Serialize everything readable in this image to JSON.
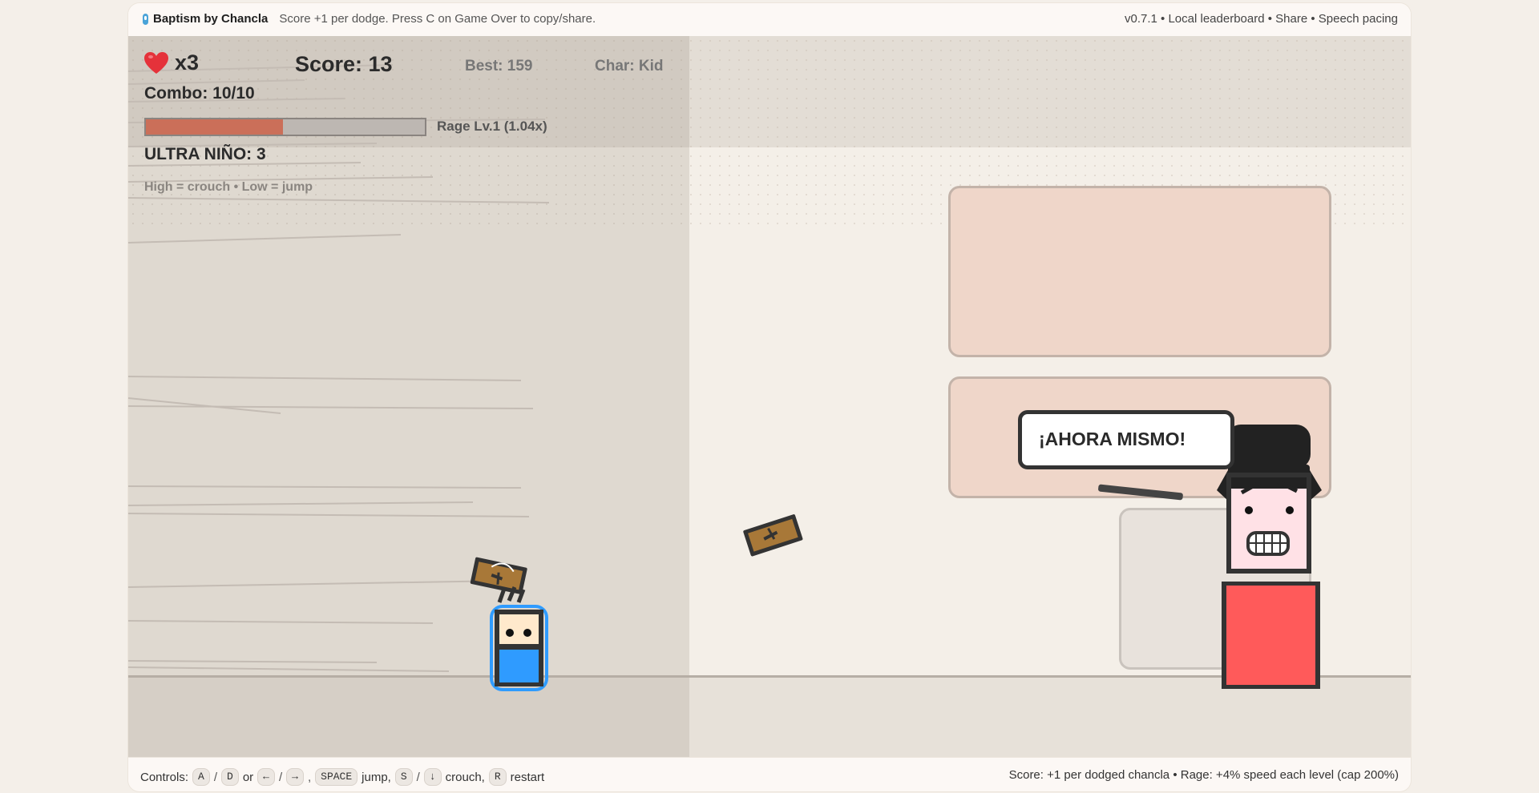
{
  "header": {
    "title": "Baptism by Chancla",
    "tagline": "Score +1 per dodge. Press C on Game Over to copy/share.",
    "meta": "v0.7.1 • Local leaderboard • Share • Speech pacing"
  },
  "hud": {
    "lives": "x3",
    "score": "Score: 13",
    "best": "Best: 159",
    "character": "Char: Kid",
    "combo": "Combo: 10/10",
    "rage_label": "Rage Lv.1 (1.04x)",
    "rage_fill": 0.49,
    "ultra": "ULTRA NIÑO: 3",
    "hint": "High = crouch • Low = jump"
  },
  "speech": {
    "text": "¡AHORA MISMO!"
  },
  "colors": {
    "accent_rage": "#cb6f59",
    "player_shirt": "#2f9bff",
    "mom_dress": "#ff5a5a",
    "chancla": "#a87838"
  },
  "footer": {
    "controls_label": "Controls:",
    "key_a": "A",
    "slash1": "/",
    "key_d": "D",
    "or": "or",
    "key_left": "←",
    "slash2": "/",
    "key_right": "→",
    "comma1": ",",
    "key_space": "SPACE",
    "jump": "jump,",
    "key_s": "S",
    "slash3": "/",
    "key_down": "↓",
    "crouch": "crouch,",
    "key_r": "R",
    "restart": "restart",
    "right": "Score: +1 per dodged chancla • Rage: +4% speed each level (cap 200%)"
  }
}
